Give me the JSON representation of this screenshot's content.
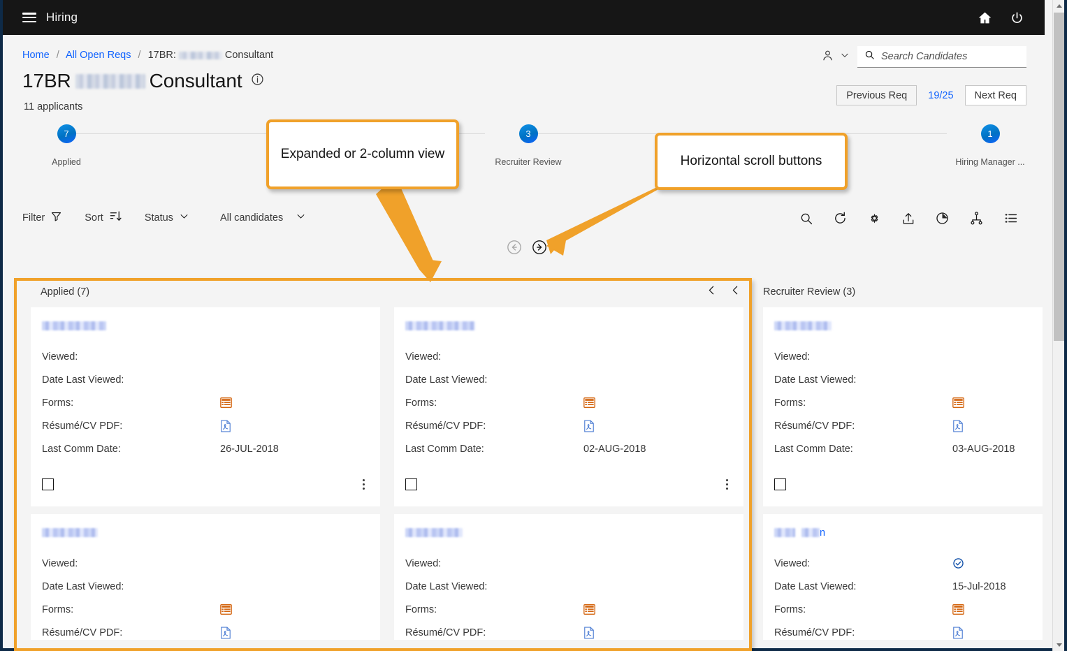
{
  "topbar": {
    "menu_icon": "hamburger-icon",
    "title": "Hiring",
    "home_icon": "home-icon",
    "power_icon": "power-icon"
  },
  "breadcrumb": {
    "home": "Home",
    "all_open_reqs": "All Open Reqs",
    "current_prefix": "17BR:",
    "current_suffix": "Consultant",
    "separator": "/"
  },
  "header": {
    "title_prefix": "17BR",
    "title_suffix": "Consultant",
    "info_icon": "info-icon",
    "applicants": "11 applicants"
  },
  "search": {
    "person_icon": "person-icon",
    "chevron_icon": "chevron-down-icon",
    "search_icon": "search-icon",
    "placeholder": "Search Candidates",
    "value": ""
  },
  "req_nav": {
    "previous_label": "Previous Req",
    "count": "19/25",
    "next_label": "Next Req"
  },
  "pipeline": {
    "stages": [
      {
        "count": "7",
        "label": "Applied"
      },
      {
        "count": "3",
        "label": "Recruiter Review"
      },
      {
        "count": "1",
        "label": "Hiring Manager ..."
      }
    ]
  },
  "toolbar": {
    "left": [
      {
        "label": "Filter",
        "icon": "funnel-icon"
      },
      {
        "label": "Sort",
        "icon": "sort-descending-icon"
      },
      {
        "label": "Status",
        "icon": "chevron-down-icon"
      },
      {
        "label": "All candidates",
        "icon": "chevron-down-icon"
      }
    ],
    "right_icons": [
      "search-icon",
      "refresh-icon",
      "settings-gear-icon",
      "upload-icon",
      "time-pie-icon",
      "hierarchy-icon",
      "list-view-icon"
    ]
  },
  "scroll_buttons": {
    "left_icon": "arrow-left-circle-icon",
    "right_icon": "arrow-right-circle-icon"
  },
  "board": {
    "column_nav": {
      "prev_icon": "chevron-left-icon",
      "prev2_icon": "chevron-left-icon"
    },
    "columns": [
      {
        "header": "Applied (7)",
        "cards": [
          {
            "name_redacted": true,
            "fields": [
              {
                "label": "Viewed:",
                "value": "",
                "icon": ""
              },
              {
                "label": "Date Last Viewed:",
                "value": "",
                "icon": ""
              },
              {
                "label": "Forms:",
                "value": "",
                "icon": "forms-icon"
              },
              {
                "label": "Résumé/CV PDF:",
                "value": "",
                "icon": "pdf-icon"
              },
              {
                "label": "Last Comm Date:",
                "value": "26-JUL-2018",
                "icon": ""
              }
            ],
            "has_checkbox": true,
            "has_kebab": true
          },
          {
            "name_redacted": true,
            "fields": [
              {
                "label": "Viewed:",
                "value": "",
                "icon": ""
              },
              {
                "label": "Date Last Viewed:",
                "value": "",
                "icon": ""
              },
              {
                "label": "Forms:",
                "value": "",
                "icon": "forms-icon"
              },
              {
                "label": "Résumé/CV PDF:",
                "value": "",
                "icon": "pdf-icon"
              }
            ],
            "has_checkbox": false,
            "has_kebab": false
          }
        ]
      },
      {
        "header": "",
        "cards": [
          {
            "name_redacted": true,
            "fields": [
              {
                "label": "Viewed:",
                "value": "",
                "icon": ""
              },
              {
                "label": "Date Last Viewed:",
                "value": "",
                "icon": ""
              },
              {
                "label": "Forms:",
                "value": "",
                "icon": "forms-icon"
              },
              {
                "label": "Résumé/CV PDF:",
                "value": "",
                "icon": "pdf-icon"
              },
              {
                "label": "Last Comm Date:",
                "value": "02-AUG-2018",
                "icon": ""
              }
            ],
            "has_checkbox": true,
            "has_kebab": true
          },
          {
            "name_redacted": true,
            "fields": [
              {
                "label": "Viewed:",
                "value": "",
                "icon": ""
              },
              {
                "label": "Date Last Viewed:",
                "value": "",
                "icon": ""
              },
              {
                "label": "Forms:",
                "value": "",
                "icon": "forms-icon"
              },
              {
                "label": "Résumé/CV PDF:",
                "value": "",
                "icon": "pdf-icon"
              }
            ],
            "has_checkbox": false,
            "has_kebab": false
          }
        ]
      },
      {
        "header": "Recruiter Review (3)",
        "cards": [
          {
            "name_redacted": true,
            "fields": [
              {
                "label": "Viewed:",
                "value": "",
                "icon": ""
              },
              {
                "label": "Date Last Viewed:",
                "value": "",
                "icon": ""
              },
              {
                "label": "Forms:",
                "value": "",
                "icon": "forms-icon"
              },
              {
                "label": "Résumé/CV PDF:",
                "value": "",
                "icon": "pdf-icon"
              },
              {
                "label": "Last Comm Date:",
                "value": "03-AUG-2018",
                "icon": ""
              }
            ],
            "has_checkbox": true,
            "has_kebab": false
          },
          {
            "name_redacted": true,
            "name_tail": "n",
            "fields": [
              {
                "label": "Viewed:",
                "value": "",
                "icon": "viewed-check-icon"
              },
              {
                "label": "Date Last Viewed:",
                "value": "15-Jul-2018",
                "icon": ""
              },
              {
                "label": "Forms:",
                "value": "",
                "icon": "forms-icon"
              },
              {
                "label": "Résumé/CV PDF:",
                "value": "",
                "icon": "pdf-icon"
              }
            ],
            "has_checkbox": false,
            "has_kebab": false
          }
        ]
      }
    ]
  },
  "annotations": [
    {
      "text": "Expanded or 2-column view"
    },
    {
      "text": "Horizontal scroll buttons"
    }
  ],
  "colors": {
    "annotation": "#f0a12a",
    "accent_blue": "#0f62fe",
    "stage_dot": "#0072c3",
    "forms_orange": "#d4650f",
    "topbar_bg": "#161616"
  }
}
